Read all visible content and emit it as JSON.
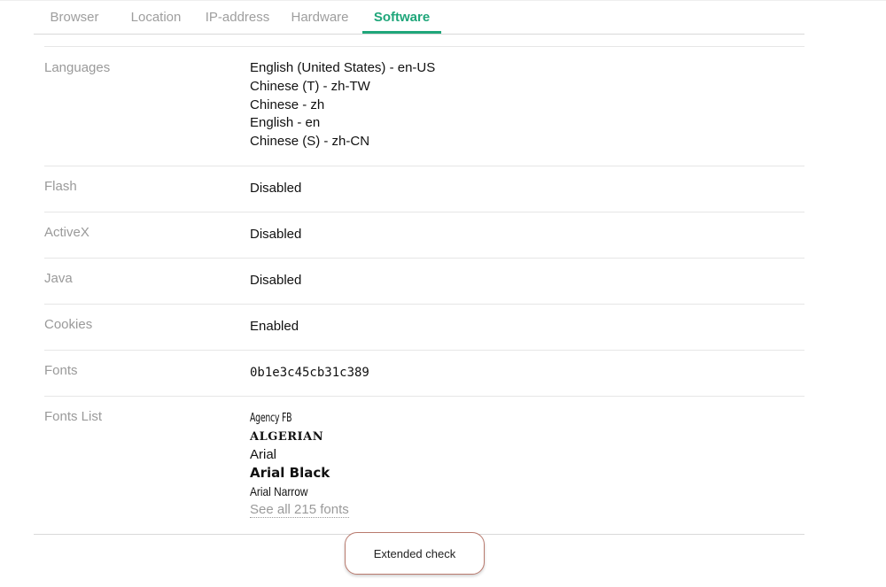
{
  "tabs": [
    {
      "label": "Browser"
    },
    {
      "label": "Location"
    },
    {
      "label": "IP-address"
    },
    {
      "label": "Hardware"
    },
    {
      "label": "Software",
      "active": true
    }
  ],
  "rows": {
    "languages": {
      "label": "Languages",
      "values": [
        "English (United States) - en-US",
        "Chinese (T) - zh-TW",
        "Chinese - zh",
        "English - en",
        "Chinese (S) - zh-CN"
      ]
    },
    "flash": {
      "label": "Flash",
      "value": "Disabled"
    },
    "activex": {
      "label": "ActiveX",
      "value": "Disabled"
    },
    "java": {
      "label": "Java",
      "value": "Disabled"
    },
    "cookies": {
      "label": "Cookies",
      "value": "Enabled"
    },
    "fonts": {
      "label": "Fonts",
      "value": "0b1e3c45cb31c389"
    },
    "fonts_list": {
      "label": "Fonts List",
      "values": [
        "Agency FB",
        "ALGERIAN",
        "Arial",
        "Arial Black",
        "Arial Narrow"
      ],
      "see_all": "See all 215 fonts"
    }
  },
  "extended_check": {
    "label": "Extended check"
  },
  "colors": {
    "accent": "#1fa67a",
    "label": "#9a9a9a",
    "button_border": "#b97a6e"
  }
}
